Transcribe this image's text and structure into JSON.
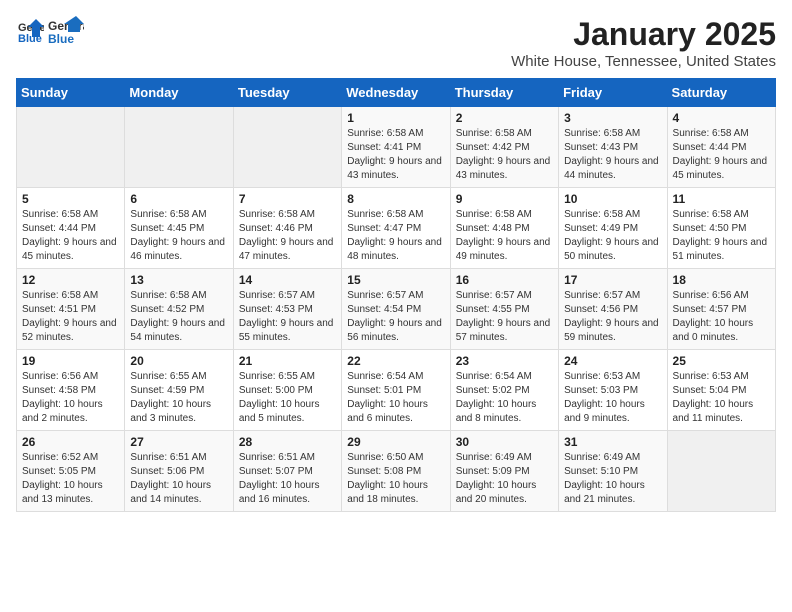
{
  "header": {
    "logo_general": "General",
    "logo_blue": "Blue",
    "month_year": "January 2025",
    "location": "White House, Tennessee, United States"
  },
  "days_of_week": [
    "Sunday",
    "Monday",
    "Tuesday",
    "Wednesday",
    "Thursday",
    "Friday",
    "Saturday"
  ],
  "weeks": [
    [
      {
        "day": "",
        "info": ""
      },
      {
        "day": "",
        "info": ""
      },
      {
        "day": "",
        "info": ""
      },
      {
        "day": "1",
        "info": "Sunrise: 6:58 AM\nSunset: 4:41 PM\nDaylight: 9 hours and 43 minutes."
      },
      {
        "day": "2",
        "info": "Sunrise: 6:58 AM\nSunset: 4:42 PM\nDaylight: 9 hours and 43 minutes."
      },
      {
        "day": "3",
        "info": "Sunrise: 6:58 AM\nSunset: 4:43 PM\nDaylight: 9 hours and 44 minutes."
      },
      {
        "day": "4",
        "info": "Sunrise: 6:58 AM\nSunset: 4:44 PM\nDaylight: 9 hours and 45 minutes."
      }
    ],
    [
      {
        "day": "5",
        "info": "Sunrise: 6:58 AM\nSunset: 4:44 PM\nDaylight: 9 hours and 45 minutes."
      },
      {
        "day": "6",
        "info": "Sunrise: 6:58 AM\nSunset: 4:45 PM\nDaylight: 9 hours and 46 minutes."
      },
      {
        "day": "7",
        "info": "Sunrise: 6:58 AM\nSunset: 4:46 PM\nDaylight: 9 hours and 47 minutes."
      },
      {
        "day": "8",
        "info": "Sunrise: 6:58 AM\nSunset: 4:47 PM\nDaylight: 9 hours and 48 minutes."
      },
      {
        "day": "9",
        "info": "Sunrise: 6:58 AM\nSunset: 4:48 PM\nDaylight: 9 hours and 49 minutes."
      },
      {
        "day": "10",
        "info": "Sunrise: 6:58 AM\nSunset: 4:49 PM\nDaylight: 9 hours and 50 minutes."
      },
      {
        "day": "11",
        "info": "Sunrise: 6:58 AM\nSunset: 4:50 PM\nDaylight: 9 hours and 51 minutes."
      }
    ],
    [
      {
        "day": "12",
        "info": "Sunrise: 6:58 AM\nSunset: 4:51 PM\nDaylight: 9 hours and 52 minutes."
      },
      {
        "day": "13",
        "info": "Sunrise: 6:58 AM\nSunset: 4:52 PM\nDaylight: 9 hours and 54 minutes."
      },
      {
        "day": "14",
        "info": "Sunrise: 6:57 AM\nSunset: 4:53 PM\nDaylight: 9 hours and 55 minutes."
      },
      {
        "day": "15",
        "info": "Sunrise: 6:57 AM\nSunset: 4:54 PM\nDaylight: 9 hours and 56 minutes."
      },
      {
        "day": "16",
        "info": "Sunrise: 6:57 AM\nSunset: 4:55 PM\nDaylight: 9 hours and 57 minutes."
      },
      {
        "day": "17",
        "info": "Sunrise: 6:57 AM\nSunset: 4:56 PM\nDaylight: 9 hours and 59 minutes."
      },
      {
        "day": "18",
        "info": "Sunrise: 6:56 AM\nSunset: 4:57 PM\nDaylight: 10 hours and 0 minutes."
      }
    ],
    [
      {
        "day": "19",
        "info": "Sunrise: 6:56 AM\nSunset: 4:58 PM\nDaylight: 10 hours and 2 minutes."
      },
      {
        "day": "20",
        "info": "Sunrise: 6:55 AM\nSunset: 4:59 PM\nDaylight: 10 hours and 3 minutes."
      },
      {
        "day": "21",
        "info": "Sunrise: 6:55 AM\nSunset: 5:00 PM\nDaylight: 10 hours and 5 minutes."
      },
      {
        "day": "22",
        "info": "Sunrise: 6:54 AM\nSunset: 5:01 PM\nDaylight: 10 hours and 6 minutes."
      },
      {
        "day": "23",
        "info": "Sunrise: 6:54 AM\nSunset: 5:02 PM\nDaylight: 10 hours and 8 minutes."
      },
      {
        "day": "24",
        "info": "Sunrise: 6:53 AM\nSunset: 5:03 PM\nDaylight: 10 hours and 9 minutes."
      },
      {
        "day": "25",
        "info": "Sunrise: 6:53 AM\nSunset: 5:04 PM\nDaylight: 10 hours and 11 minutes."
      }
    ],
    [
      {
        "day": "26",
        "info": "Sunrise: 6:52 AM\nSunset: 5:05 PM\nDaylight: 10 hours and 13 minutes."
      },
      {
        "day": "27",
        "info": "Sunrise: 6:51 AM\nSunset: 5:06 PM\nDaylight: 10 hours and 14 minutes."
      },
      {
        "day": "28",
        "info": "Sunrise: 6:51 AM\nSunset: 5:07 PM\nDaylight: 10 hours and 16 minutes."
      },
      {
        "day": "29",
        "info": "Sunrise: 6:50 AM\nSunset: 5:08 PM\nDaylight: 10 hours and 18 minutes."
      },
      {
        "day": "30",
        "info": "Sunrise: 6:49 AM\nSunset: 5:09 PM\nDaylight: 10 hours and 20 minutes."
      },
      {
        "day": "31",
        "info": "Sunrise: 6:49 AM\nSunset: 5:10 PM\nDaylight: 10 hours and 21 minutes."
      },
      {
        "day": "",
        "info": ""
      }
    ]
  ]
}
